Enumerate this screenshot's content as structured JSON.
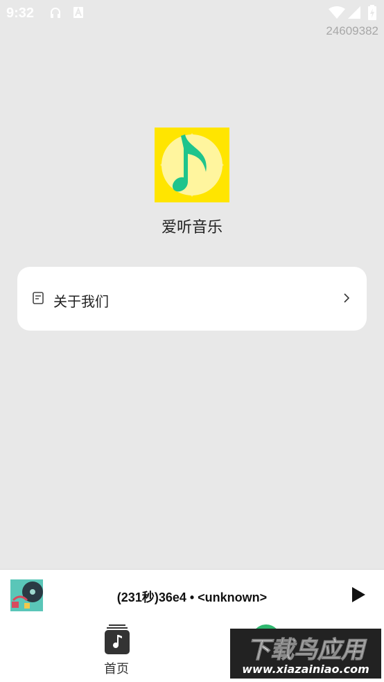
{
  "status_bar": {
    "time": "9:32",
    "left_icons": [
      "headphones-icon",
      "a-badge-icon"
    ],
    "right_icons": [
      "wifi-icon",
      "signal-icon",
      "battery-charging-icon"
    ]
  },
  "build_id": "24609382",
  "app": {
    "name": "爱听音乐",
    "logo_icon": "music-note-icon",
    "logo_bg": "#ffe500",
    "logo_note_color": "#1fc48c"
  },
  "menu": {
    "about": {
      "label": "关于我们",
      "icon": "document-icon",
      "chevron": "chevron-right-icon"
    }
  },
  "player": {
    "track_text": "(231秒)36e4 • <unknown>",
    "cover_icon": "album-art",
    "play_icon": "play-icon"
  },
  "tabs": [
    {
      "label": "首页",
      "icon": "music-album-icon"
    },
    {
      "label": "",
      "icon": "green-tab-icon"
    }
  ],
  "watermark": {
    "title": "下载鸟应用",
    "url": "www.xiazainiao.com"
  }
}
